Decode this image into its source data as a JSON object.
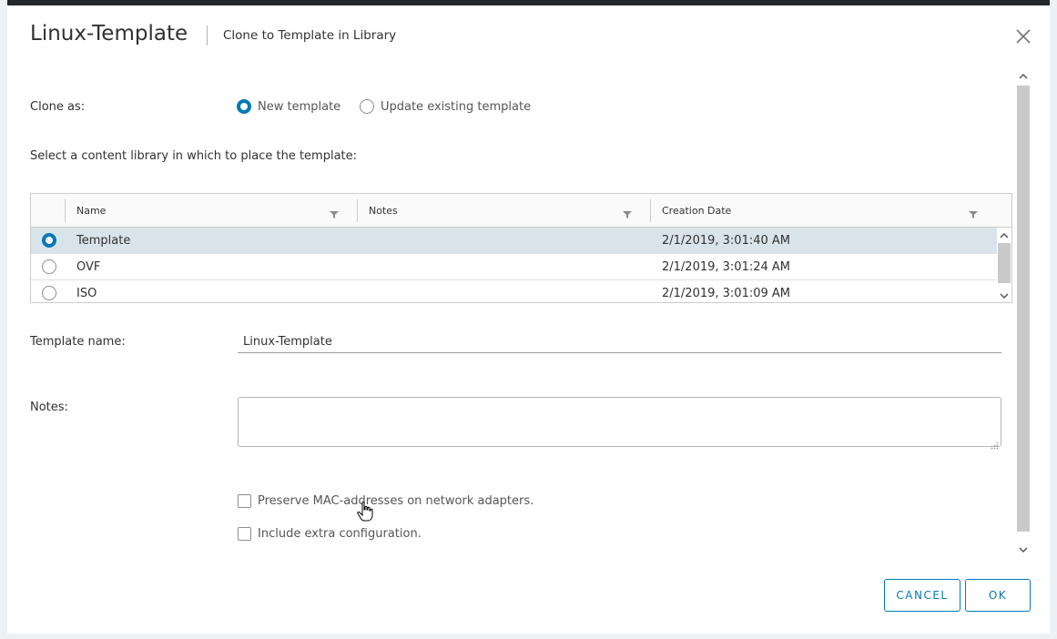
{
  "dialog": {
    "title": "Linux-Template",
    "subtitle": "Clone to Template in Library"
  },
  "clone_as": {
    "label": "Clone as:",
    "options": [
      {
        "label": "New template",
        "selected": true
      },
      {
        "label": "Update existing template",
        "selected": false
      }
    ]
  },
  "library": {
    "prompt": "Select a content library in which to place the template:",
    "columns": [
      "Name",
      "Notes",
      "Creation Date"
    ],
    "rows": [
      {
        "name": "Template",
        "notes": "",
        "date": "2/1/2019, 3:01:40 AM",
        "selected": true
      },
      {
        "name": "OVF",
        "notes": "",
        "date": "2/1/2019, 3:01:24 AM",
        "selected": false
      },
      {
        "name": "ISO",
        "notes": "",
        "date": "2/1/2019, 3:01:09 AM",
        "selected": false
      }
    ]
  },
  "template_name": {
    "label": "Template name:",
    "value": "Linux-Template"
  },
  "notes": {
    "label": "Notes:",
    "value": ""
  },
  "options": {
    "preserve_mac": {
      "label": "Preserve MAC-addresses on network adapters.",
      "checked": false
    },
    "include_extra": {
      "label": "Include extra configuration.",
      "checked": false
    }
  },
  "buttons": {
    "cancel": "CANCEL",
    "ok": "OK"
  },
  "colors": {
    "accent": "#0079b8",
    "selected_row": "#d9e4ea"
  }
}
